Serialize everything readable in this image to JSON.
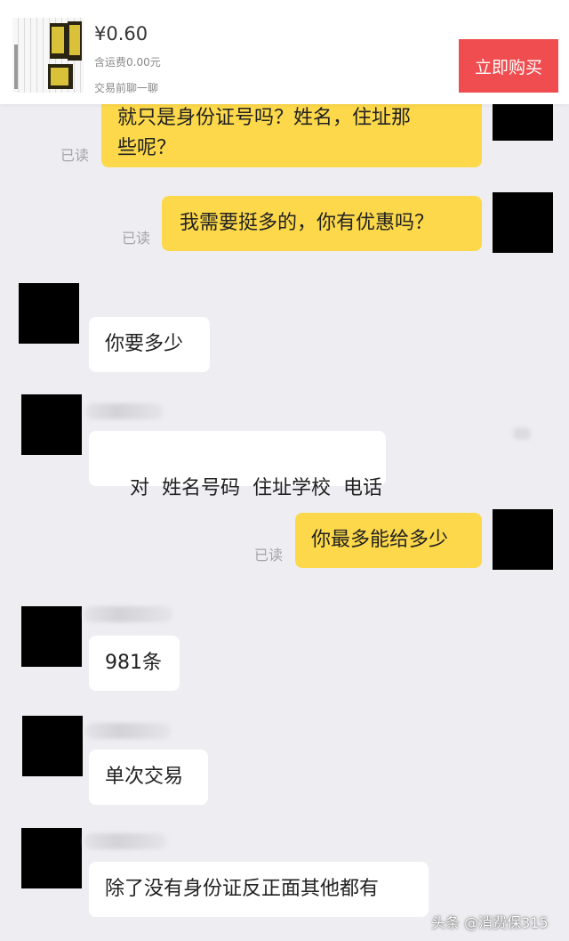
{
  "header": {
    "price": "¥0.60",
    "shipping": "含运费0.00元",
    "chat_before_trade": "交易前聊一聊",
    "buy_button": "立即购买"
  },
  "messages": [
    {
      "side": "me",
      "read": "已读",
      "text_lines": [
        "就只是身份证号吗？姓名，住址那",
        "些呢？"
      ]
    },
    {
      "side": "me",
      "read": "已读",
      "text": "我需要挺多的，你有优惠吗？"
    },
    {
      "side": "them",
      "text": "你要多少"
    },
    {
      "side": "them",
      "text": "对  姓名号码  住址学校  电话"
    },
    {
      "side": "me",
      "read": "已读",
      "text": "你最多能给多少"
    },
    {
      "side": "them",
      "text": "981条"
    },
    {
      "side": "them",
      "text": "单次交易"
    },
    {
      "side": "them",
      "text": "除了没有身份证反正面其他都有"
    }
  ],
  "watermark": "头条 @消费保315",
  "colors": {
    "my_bubble": "#fcd84a",
    "their_bubble": "#ffffff",
    "buy_button": "#ef4d50",
    "background": "#eeeef2"
  }
}
